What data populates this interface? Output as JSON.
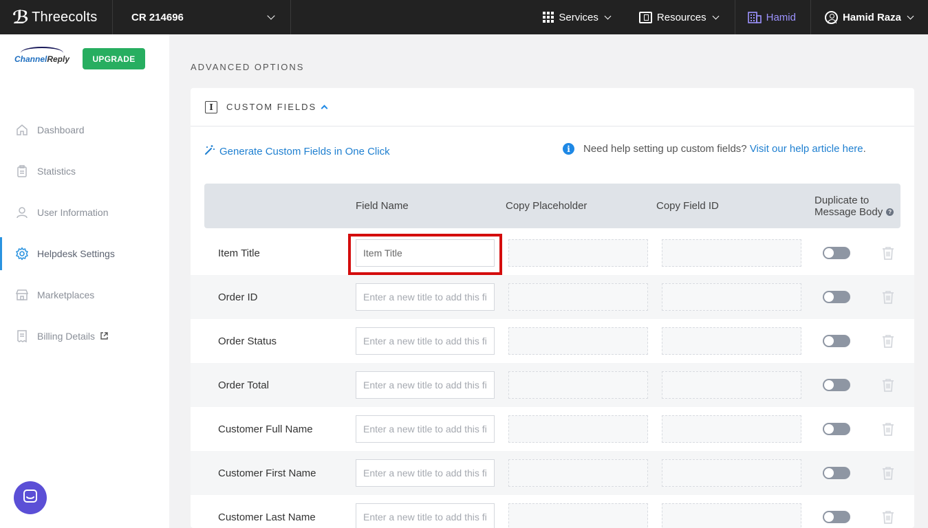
{
  "topbar": {
    "brand": "Threecolts",
    "account": "CR 214696",
    "services": "Services",
    "resources": "Resources",
    "workspace": "Hamid",
    "user": "Hamid Raza"
  },
  "sidebar": {
    "logo_part1": "Channel",
    "logo_part2": "Reply",
    "upgrade": "UPGRADE",
    "items": [
      {
        "label": "Dashboard",
        "icon": "home-icon"
      },
      {
        "label": "Statistics",
        "icon": "clipboard-icon"
      },
      {
        "label": "User Information",
        "icon": "user-icon"
      },
      {
        "label": "Helpdesk Settings",
        "icon": "gear-icon",
        "active": true
      },
      {
        "label": "Marketplaces",
        "icon": "store-icon"
      },
      {
        "label": "Billing Details",
        "icon": "receipt-icon"
      }
    ]
  },
  "main": {
    "section_title": "ADVANCED OPTIONS",
    "card_title": "CUSTOM FIELDS",
    "generate_link": "Generate Custom Fields in One Click",
    "help_text": "Need help setting up custom fields?",
    "help_link": "Visit our help article here",
    "help_period": ".",
    "columns": {
      "field_name": "Field Name",
      "copy_placeholder": "Copy Placeholder",
      "copy_field_id": "Copy Field ID",
      "duplicate_line1": "Duplicate to",
      "duplicate_line2": "Message Body"
    },
    "input_placeholder": "Enter a new title to add this field",
    "rows": [
      {
        "label": "Item Title",
        "value": "Item Title"
      },
      {
        "label": "Order ID",
        "value": ""
      },
      {
        "label": "Order Status",
        "value": ""
      },
      {
        "label": "Order Total",
        "value": ""
      },
      {
        "label": "Customer Full Name",
        "value": ""
      },
      {
        "label": "Customer First Name",
        "value": ""
      },
      {
        "label": "Customer Last Name",
        "value": ""
      }
    ]
  },
  "colors": {
    "topbar_bg": "#222222",
    "accent_blue": "#1e7fd0",
    "upgrade_green": "#27ae60",
    "workspace_purple": "#9d93ff",
    "highlight_red": "#d40d0d",
    "chat_purple": "#5b4fd6"
  }
}
